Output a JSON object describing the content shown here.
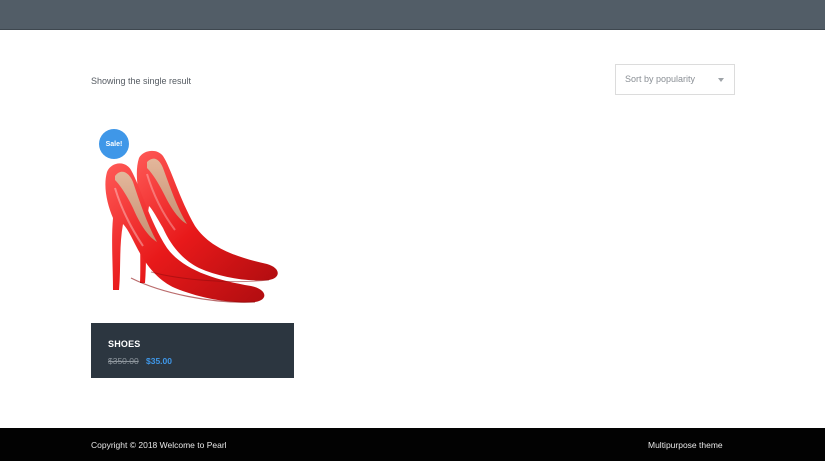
{
  "shop": {
    "result_count": "Showing the single result",
    "sort_label": "Sort by popularity"
  },
  "product": {
    "badge": "Sale!",
    "title": "SHOES",
    "price_old": "$350.00",
    "price_new": "$35.00",
    "image_icon": "red-high-heel-shoes-image"
  },
  "footer": {
    "copyright": "Copyright © 2018 Welcome to Pearl",
    "theme": "Multipurpose theme"
  },
  "colors": {
    "topbar": "#525d67",
    "accent": "#3f97e8",
    "product_info_bg": "#2c3640",
    "footer_bg": "#020202"
  }
}
